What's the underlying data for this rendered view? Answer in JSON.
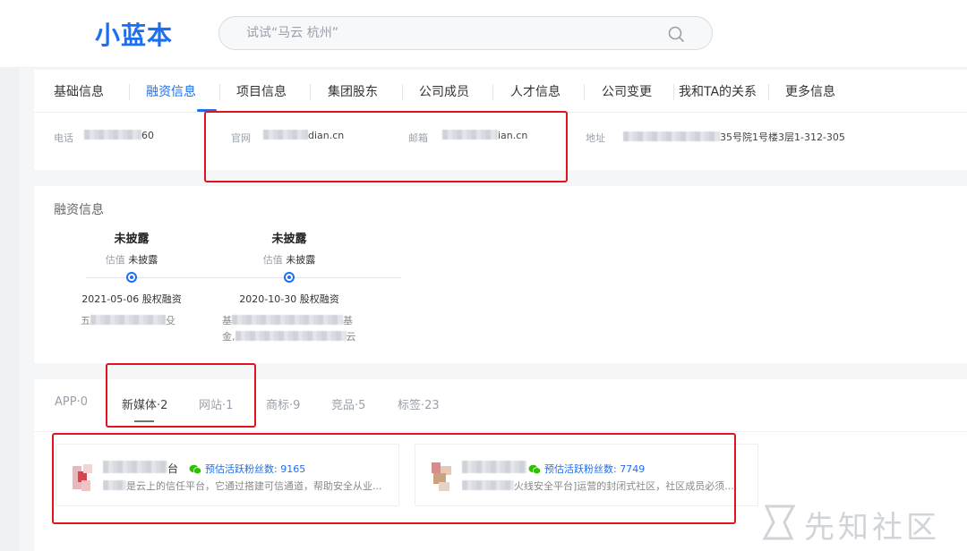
{
  "header": {
    "logo": "小蓝本",
    "search_placeholder": "试试“马云 杭州”"
  },
  "tabs": [
    {
      "label": "基础信息"
    },
    {
      "label": "融资信息",
      "active": true
    },
    {
      "label": "项目信息"
    },
    {
      "label": "集团股东"
    },
    {
      "label": "公司成员"
    },
    {
      "label": "人才信息"
    },
    {
      "label": "公司变更"
    },
    {
      "label": "我和TA的关系"
    },
    {
      "label": "更多信息"
    }
  ],
  "contact": {
    "phone_label": "电话",
    "phone_value": "60",
    "website_label": "官网",
    "website_value": "dian.cn",
    "email_label": "邮箱",
    "email_value": "ian.cn",
    "address_label": "地址",
    "address_value": "35号院1号楼3层1-312-305"
  },
  "funding": {
    "title": "融资信息",
    "valuation_label": "估值",
    "rounds": [
      {
        "round": "未披露",
        "valuation": "未披露",
        "date": "2021-05-06",
        "type": "股权融资",
        "investors": [
          "五",
          "殳"
        ]
      },
      {
        "round": "未披露",
        "valuation": "未披露",
        "date": "2020-10-30",
        "type": "股权融资",
        "investors": [
          "基",
          "基",
          "金,",
          "云"
        ]
      }
    ]
  },
  "media": {
    "tabs": [
      {
        "label": "APP·0"
      },
      {
        "label": "新媒体·2",
        "active": true
      },
      {
        "label": "网站·1"
      },
      {
        "label": "商标·9"
      },
      {
        "label": "竞品·5"
      },
      {
        "label": "标签·23"
      }
    ],
    "fans_label": "预估活跃粉丝数:",
    "cards": [
      {
        "name_tail": "台",
        "fans": "9165",
        "desc": "是云上的信任平台，它通过搭建可信通道，帮助安全从业..."
      },
      {
        "name_tail": "",
        "fans": "7749",
        "desc": "火线安全平台]运营的封闭式社区，社区成员必须..."
      }
    ]
  },
  "watermark": {
    "text": "先知社区"
  },
  "colors": {
    "accent": "#1d6ff2",
    "highlight": "#e0141e",
    "wechat": "#2dc100"
  },
  "icons": [
    "search-icon",
    "wechat-icon",
    "watermark-logo-icon"
  ]
}
